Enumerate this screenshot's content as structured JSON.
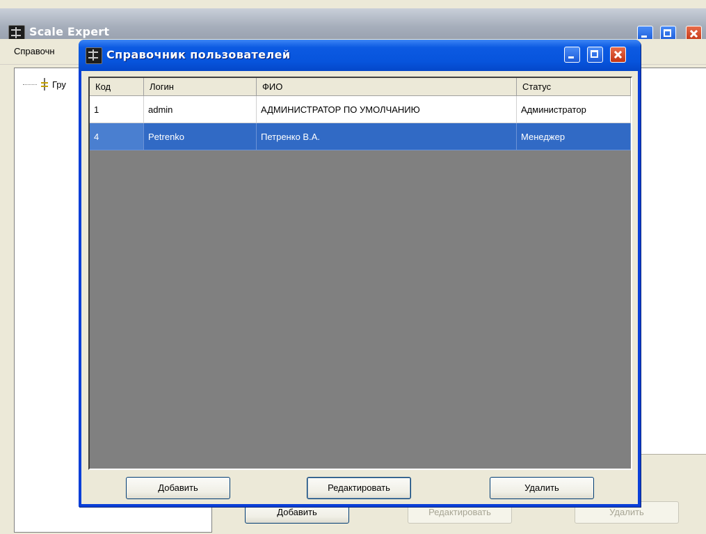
{
  "main_window": {
    "title": "Scale Expert",
    "menu": [
      "Справочн"
    ],
    "tree": {
      "root_label": "Гру"
    },
    "buttons": {
      "add": "Добавить",
      "edit": "Редактировать",
      "delete": "Удалить"
    }
  },
  "dialog": {
    "title": "Справочник пользователей",
    "table": {
      "columns": [
        "Код",
        "Логин",
        "ФИО",
        "Статус"
      ],
      "rows": [
        {
          "code": "1",
          "login": "admin",
          "fio": "АДМИНИСТРАТОР ПО УМОЛЧАНИЮ",
          "status": "Администратор",
          "selected": false
        },
        {
          "code": "4",
          "login": "Petrenko",
          "fio": "Петренко В.А.",
          "status": "Менеджер",
          "selected": true
        }
      ]
    },
    "buttons": {
      "add": "Добавить",
      "edit": "Редактировать",
      "delete": "Удалить"
    }
  },
  "colors": {
    "xp_titlebar_blue": "#0754dc",
    "selection_blue": "#316ac5",
    "grid_background": "#808080",
    "window_face": "#ece9d8",
    "close_red": "#c33413"
  },
  "icons": {
    "app": "scale-icon",
    "minimize": "minimize-icon",
    "maximize": "maximize-icon",
    "close": "close-icon",
    "tree_node": "tree-node-icon"
  }
}
